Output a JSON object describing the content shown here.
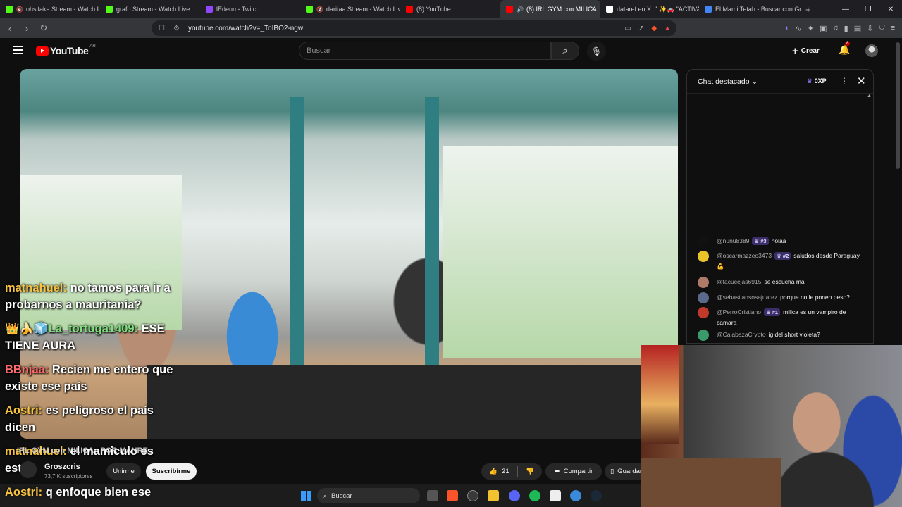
{
  "browser": {
    "tabs": [
      {
        "label": "ohsifake Stream - Watch Li",
        "favicon_color": "#53fc18",
        "icon": "mute-icon"
      },
      {
        "label": "grafo Stream - Watch Live",
        "favicon_color": "#53fc18",
        "icon": ""
      },
      {
        "label": "lEdenn - Twitch",
        "favicon_color": "#9146ff",
        "icon": ""
      },
      {
        "label": "daritaa Stream - Watch Liv",
        "favicon_color": "#53fc18",
        "icon": "mute-icon"
      },
      {
        "label": "(8) YouTube",
        "favicon_color": "#ff0000",
        "icon": ""
      },
      {
        "label": "(8) IRL GYM con MILICA",
        "favicon_color": "#ff0000",
        "icon": "audio-icon",
        "active": true
      },
      {
        "label": "dataref en X: \" ✨🚗 \"ACTIVAM",
        "favicon_color": "#ffffff",
        "icon": ""
      },
      {
        "label": "El Mami Tetah - Buscar con Go",
        "favicon_color": "#4285f4",
        "icon": ""
      }
    ],
    "url": "youtube.com/watch?v=_ToIBO2-ngw"
  },
  "youtube": {
    "logo_text": "YouTube",
    "region": "AR",
    "search_placeholder": "Buscar",
    "create_label": "Crear",
    "notifications_count": "8"
  },
  "video_overlay_chat": [
    {
      "user": "matnahuel:",
      "text": " no tamos para ir a",
      "line2": "probarnos a mauritania?",
      "color": "n1"
    },
    {
      "user": "👑🍌🧊La_tortuga1409:",
      "text": " ESE",
      "line2": "TIENE AURA",
      "color": "n2"
    },
    {
      "user": "BBnjaa:",
      "text": " Recien me entero que",
      "line2": "existe ese pais",
      "color": "n3"
    },
    {
      "user": "Aostri:",
      "text": " es peligroso el país",
      "line2": "dicen",
      "color": "n1"
    },
    {
      "user": "matnahuel:",
      "text": " el mamiculo es",
      "line2": "este",
      "color": "n1"
    }
  ],
  "video_title_partial": "IRL GYM con MILICA - POR MANRE",
  "channel": {
    "name": "Groszcris",
    "subscribers": "73,7 K suscriptores",
    "join_label": "Unirme",
    "subscribe_label": "Suscribirme"
  },
  "actions": {
    "likes": "21",
    "share_label": "Compartir",
    "save_label": "Guardar"
  },
  "chat": {
    "title": "Chat destacado",
    "xp_label": "0XP",
    "messages": [
      {
        "user": "@nunu8389",
        "rank": "#3",
        "text": "holaa",
        "avatar_color": "#111111"
      },
      {
        "user": "@oscarmazzeo3473",
        "rank": "#2",
        "text": "saludos desde Paraguay 💪",
        "avatar_color": "#e8c42a"
      },
      {
        "user": "@facucejas6915",
        "rank": "",
        "text": "se escucha mal",
        "avatar_color": "#b07a6a"
      },
      {
        "user": "@sebastiansosajuarez",
        "rank": "",
        "text": "porque no le ponen peso?",
        "avatar_color": "#5a6a8a"
      },
      {
        "user": "@PerroCristiano",
        "rank": "#1",
        "text": "milica es un vampiro de camara",
        "avatar_color": "#c0392b"
      },
      {
        "user": "@CalabazaCrypto",
        "rank": "",
        "text": "ig del short violeta?",
        "avatar_color": "#3a9a6a"
      }
    ]
  },
  "taskbar": {
    "search_placeholder": "Buscar",
    "bottom_overlay_user": "Aostri:",
    "bottom_overlay_text": " q enfoque bien ese"
  }
}
